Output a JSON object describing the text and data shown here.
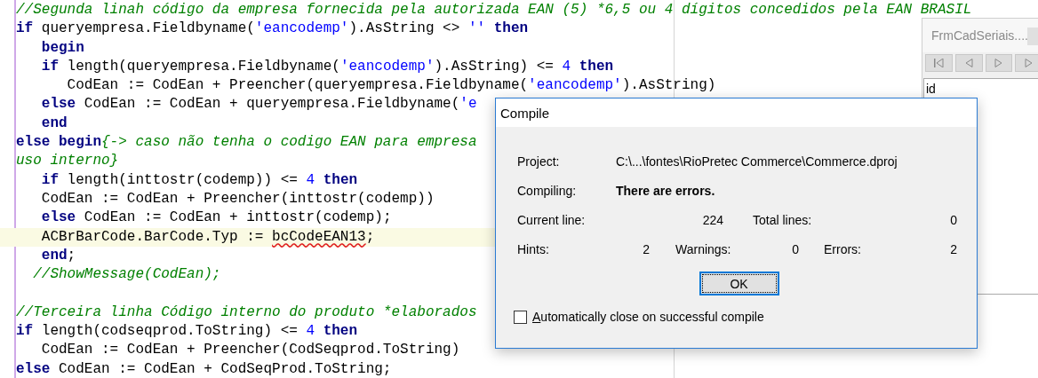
{
  "editor": {
    "lines": [
      {
        "current": false,
        "tokens": [
          {
            "kind": "comment",
            "text": "//Segunda linah código da empresa fornecida pela autorizada EAN (5) *6,5 ou 4 dígitos concedidos pela EAN BRASIL"
          }
        ]
      },
      {
        "current": false,
        "tokens": [
          {
            "kind": "keyword",
            "text": "if"
          },
          {
            "kind": "plain",
            "text": " queryempresa.Fieldbyname("
          },
          {
            "kind": "string",
            "text": "'eancodemp'"
          },
          {
            "kind": "plain",
            "text": ").AsString <> "
          },
          {
            "kind": "string",
            "text": "''"
          },
          {
            "kind": "keyword",
            "text": " then"
          }
        ]
      },
      {
        "current": false,
        "tokens": [
          {
            "kind": "keyword",
            "text": "   begin"
          }
        ]
      },
      {
        "current": false,
        "tokens": [
          {
            "kind": "keyword",
            "text": "   if"
          },
          {
            "kind": "plain",
            "text": " length(queryempresa.Fieldbyname("
          },
          {
            "kind": "string",
            "text": "'eancodemp'"
          },
          {
            "kind": "plain",
            "text": ").AsString) <= "
          },
          {
            "kind": "number",
            "text": "4"
          },
          {
            "kind": "keyword",
            "text": " then"
          }
        ]
      },
      {
        "current": false,
        "tokens": [
          {
            "kind": "plain",
            "text": "      CodEan := CodEan + Preencher(queryempresa.Fieldbyname("
          },
          {
            "kind": "string",
            "text": "'eancodemp'"
          },
          {
            "kind": "plain",
            "text": ").AsString)"
          }
        ]
      },
      {
        "current": false,
        "tokens": [
          {
            "kind": "keyword",
            "text": "   else"
          },
          {
            "kind": "plain",
            "text": " CodEan := CodEan + queryempresa.Fieldbyname("
          },
          {
            "kind": "string",
            "text": "'e"
          }
        ]
      },
      {
        "current": false,
        "tokens": [
          {
            "kind": "keyword",
            "text": "   end"
          }
        ]
      },
      {
        "current": false,
        "tokens": [
          {
            "kind": "keyword",
            "text": "else begin"
          },
          {
            "kind": "comment",
            "text": "{-> caso não tenha o codigo EAN para empresa"
          }
        ]
      },
      {
        "current": false,
        "tokens": [
          {
            "kind": "comment",
            "text": "uso interno}"
          }
        ]
      },
      {
        "current": false,
        "tokens": [
          {
            "kind": "keyword",
            "text": "   if"
          },
          {
            "kind": "plain",
            "text": " length(inttostr(codemp)) <= "
          },
          {
            "kind": "number",
            "text": "4"
          },
          {
            "kind": "keyword",
            "text": " then"
          }
        ]
      },
      {
        "current": false,
        "tokens": [
          {
            "kind": "plain",
            "text": "   CodEan := CodEan + Preencher(inttostr(codemp))"
          }
        ]
      },
      {
        "current": false,
        "tokens": [
          {
            "kind": "keyword",
            "text": "   else"
          },
          {
            "kind": "plain",
            "text": " CodEan := CodEan + inttostr(codemp);"
          }
        ]
      },
      {
        "current": true,
        "tokens": [
          {
            "kind": "plain",
            "text": "   ACBrBarCode.BarCode.Typ := "
          },
          {
            "kind": "error",
            "text": "bcCodeEAN13"
          },
          {
            "kind": "plain",
            "text": ";"
          }
        ]
      },
      {
        "current": false,
        "tokens": [
          {
            "kind": "keyword",
            "text": "   end"
          },
          {
            "kind": "plain",
            "text": ";"
          }
        ]
      },
      {
        "current": false,
        "tokens": [
          {
            "kind": "comment",
            "text": "  //ShowMessage(CodEan);"
          }
        ]
      },
      {
        "current": false
      },
      {
        "current": false,
        "tokens": [
          {
            "kind": "comment",
            "text": "//Terceira linha Código interno do produto *elaborados"
          }
        ]
      },
      {
        "current": false,
        "tokens": [
          {
            "kind": "keyword",
            "text": "if"
          },
          {
            "kind": "plain",
            "text": " length(codseqprod.ToString) <= "
          },
          {
            "kind": "number",
            "text": "4"
          },
          {
            "kind": "keyword",
            "text": " then"
          }
        ]
      },
      {
        "current": false,
        "tokens": [
          {
            "kind": "plain",
            "text": "   CodEan := CodEan + Preencher(CodSeqprod.ToString)"
          }
        ]
      },
      {
        "current": false,
        "tokens": [
          {
            "kind": "keyword",
            "text": "else"
          },
          {
            "kind": "plain",
            "text": " CodEan := CodEan + CodSeqProd.ToString;"
          }
        ]
      }
    ]
  },
  "side_window": {
    "title": "FrmCadSeriais....",
    "list_items": [
      "id"
    ]
  },
  "dialog": {
    "title": "Compile",
    "fields": [
      {
        "label": "Project:",
        "value": "C:\\...\\fontes\\RioPretec Commerce\\Commerce.dproj",
        "kind": "text"
      },
      {
        "label": "Compiling:",
        "value": "There are errors.",
        "kind": "status"
      }
    ],
    "counters": [
      [
        {
          "label": "Current line:",
          "value": "224"
        },
        {
          "label": "Total lines:",
          "value": "0"
        }
      ],
      [
        {
          "label": "Hints:",
          "value": "2"
        },
        {
          "label": "Warnings:",
          "value": "0"
        },
        {
          "label": "Errors:",
          "value": "2"
        }
      ]
    ],
    "ok_button": "OK",
    "checkbox": {
      "label": "Automatically close on successful compile",
      "checked": false
    }
  }
}
